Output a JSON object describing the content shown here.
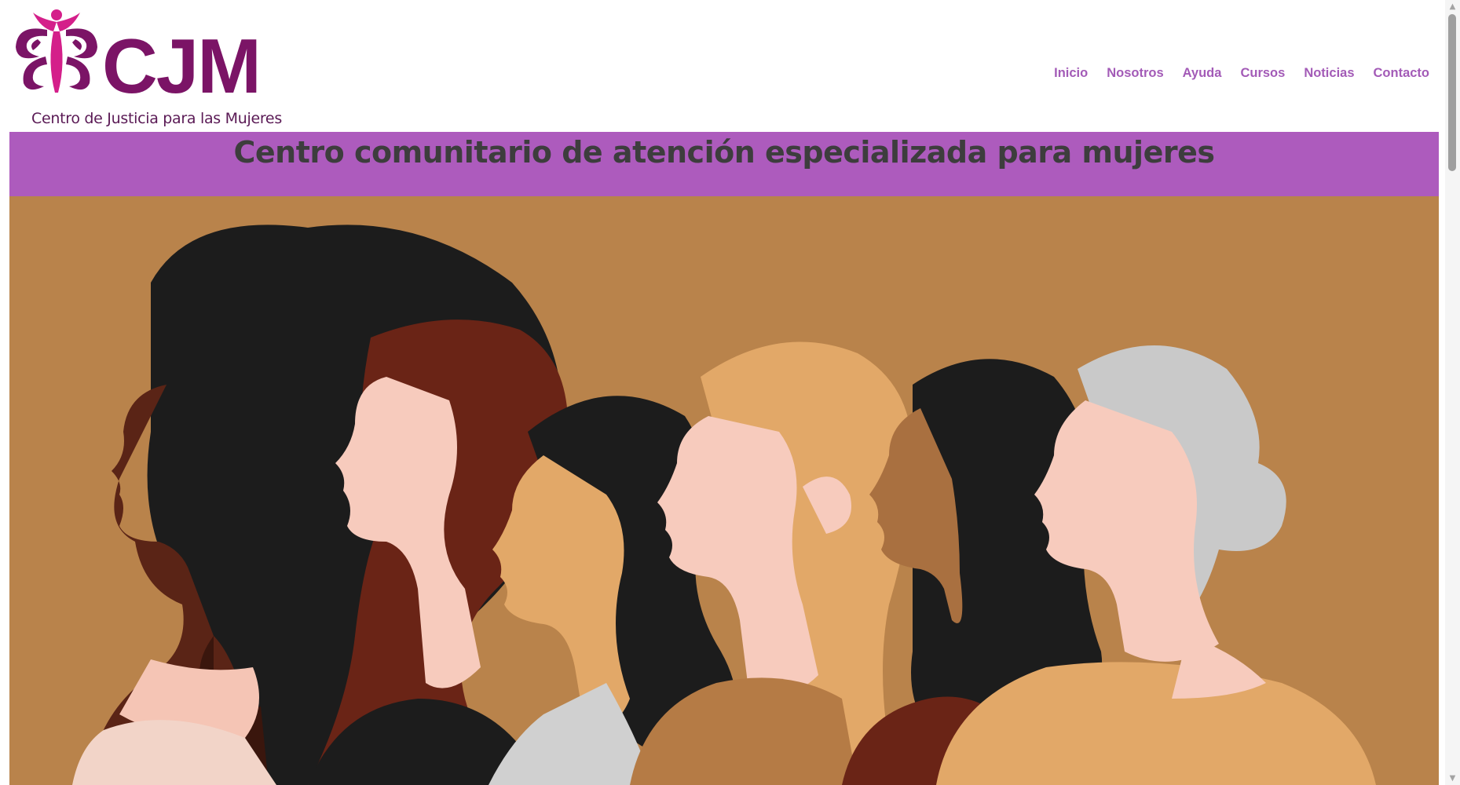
{
  "header": {
    "logo": {
      "acronym": "CJM",
      "subtitle": "Centro de Justicia para las Mujeres",
      "brand_color": "#7b1466",
      "accent_color": "#d41f8a"
    },
    "nav": {
      "items": [
        {
          "label": "Inicio"
        },
        {
          "label": "Nosotros"
        },
        {
          "label": "Ayuda"
        },
        {
          "label": "Cursos"
        },
        {
          "label": "Noticias"
        },
        {
          "label": "Contacto"
        }
      ],
      "color": "#a35bb7"
    }
  },
  "banner": {
    "title": "Centro comunitario de atención especializada para mujeres",
    "background": "#ad5bbd",
    "text_color": "#3d3d3d"
  },
  "hero": {
    "icon": "women-profiles-illustration",
    "background": "#b9834b"
  },
  "scrollbar": {
    "up_icon": "scroll-up-arrow",
    "down_icon": "scroll-down-arrow"
  }
}
